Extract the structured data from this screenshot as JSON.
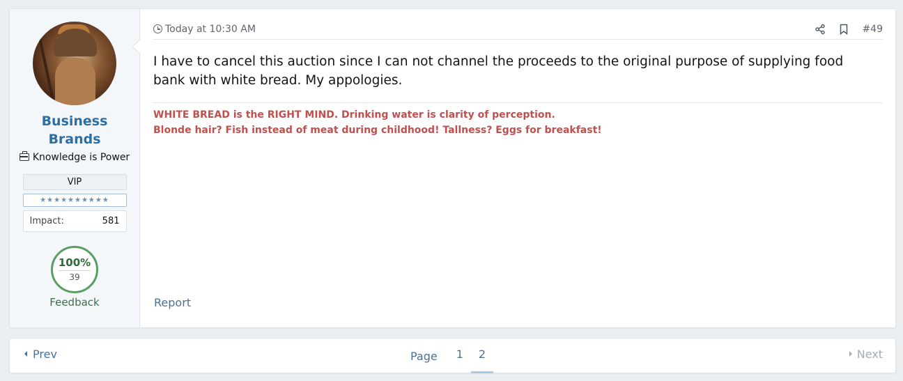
{
  "user": {
    "name": "Business Brands",
    "title": "Knowledge is Power",
    "banner": "VIP",
    "stars": "★★★★★★★★★★",
    "impact_label": "Impact:",
    "impact_value": "581",
    "feedback_percent": "100%",
    "feedback_count": "39",
    "feedback_label": "Feedback"
  },
  "post": {
    "timestamp": "Today at 10:30 AM",
    "number": "#49",
    "body": "I have to cancel this auction since I can not channel the proceeds to the original purpose of supplying food bank with white bread. My appologies.",
    "signature_line1": "WHITE BREAD is the RIGHT MIND. Drinking water is clarity of perception.",
    "signature_line2": "Blonde hair? Fish instead of meat during childhood! Tallness? Eggs for breakfast!",
    "signature_color": "#c0504d",
    "report_label": "Report"
  },
  "pagination": {
    "prev_label": "Prev",
    "next_label": "Next",
    "page_label": "Page",
    "pages": [
      "1",
      "2"
    ],
    "current_page": "2"
  },
  "colors": {
    "accent": "#2d6ea5",
    "link": "#47729e",
    "feedback_green": "#5b9e63"
  }
}
